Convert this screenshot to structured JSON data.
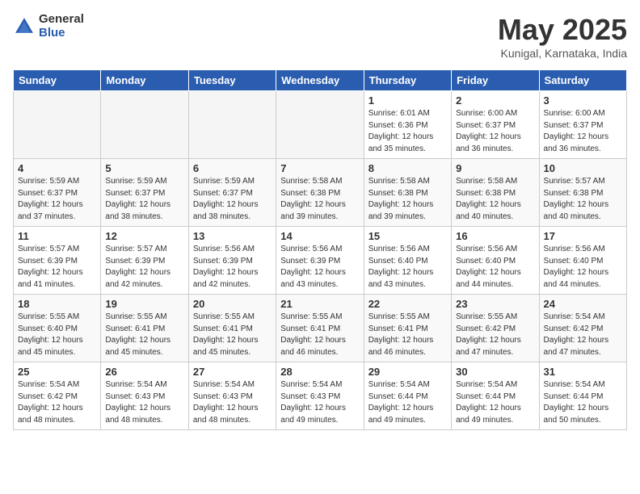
{
  "logo": {
    "general": "General",
    "blue": "Blue"
  },
  "title": "May 2025",
  "location": "Kunigal, Karnataka, India",
  "days_of_week": [
    "Sunday",
    "Monday",
    "Tuesday",
    "Wednesday",
    "Thursday",
    "Friday",
    "Saturday"
  ],
  "weeks": [
    [
      {
        "num": "",
        "empty": true
      },
      {
        "num": "",
        "empty": true
      },
      {
        "num": "",
        "empty": true
      },
      {
        "num": "",
        "empty": true
      },
      {
        "num": "1",
        "sunrise": "6:01 AM",
        "sunset": "6:36 PM",
        "daylight": "12 hours and 35 minutes."
      },
      {
        "num": "2",
        "sunrise": "6:00 AM",
        "sunset": "6:37 PM",
        "daylight": "12 hours and 36 minutes."
      },
      {
        "num": "3",
        "sunrise": "6:00 AM",
        "sunset": "6:37 PM",
        "daylight": "12 hours and 36 minutes."
      }
    ],
    [
      {
        "num": "4",
        "sunrise": "5:59 AM",
        "sunset": "6:37 PM",
        "daylight": "12 hours and 37 minutes."
      },
      {
        "num": "5",
        "sunrise": "5:59 AM",
        "sunset": "6:37 PM",
        "daylight": "12 hours and 38 minutes."
      },
      {
        "num": "6",
        "sunrise": "5:59 AM",
        "sunset": "6:37 PM",
        "daylight": "12 hours and 38 minutes."
      },
      {
        "num": "7",
        "sunrise": "5:58 AM",
        "sunset": "6:38 PM",
        "daylight": "12 hours and 39 minutes."
      },
      {
        "num": "8",
        "sunrise": "5:58 AM",
        "sunset": "6:38 PM",
        "daylight": "12 hours and 39 minutes."
      },
      {
        "num": "9",
        "sunrise": "5:58 AM",
        "sunset": "6:38 PM",
        "daylight": "12 hours and 40 minutes."
      },
      {
        "num": "10",
        "sunrise": "5:57 AM",
        "sunset": "6:38 PM",
        "daylight": "12 hours and 40 minutes."
      }
    ],
    [
      {
        "num": "11",
        "sunrise": "5:57 AM",
        "sunset": "6:39 PM",
        "daylight": "12 hours and 41 minutes."
      },
      {
        "num": "12",
        "sunrise": "5:57 AM",
        "sunset": "6:39 PM",
        "daylight": "12 hours and 42 minutes."
      },
      {
        "num": "13",
        "sunrise": "5:56 AM",
        "sunset": "6:39 PM",
        "daylight": "12 hours and 42 minutes."
      },
      {
        "num": "14",
        "sunrise": "5:56 AM",
        "sunset": "6:39 PM",
        "daylight": "12 hours and 43 minutes."
      },
      {
        "num": "15",
        "sunrise": "5:56 AM",
        "sunset": "6:40 PM",
        "daylight": "12 hours and 43 minutes."
      },
      {
        "num": "16",
        "sunrise": "5:56 AM",
        "sunset": "6:40 PM",
        "daylight": "12 hours and 44 minutes."
      },
      {
        "num": "17",
        "sunrise": "5:56 AM",
        "sunset": "6:40 PM",
        "daylight": "12 hours and 44 minutes."
      }
    ],
    [
      {
        "num": "18",
        "sunrise": "5:55 AM",
        "sunset": "6:40 PM",
        "daylight": "12 hours and 45 minutes."
      },
      {
        "num": "19",
        "sunrise": "5:55 AM",
        "sunset": "6:41 PM",
        "daylight": "12 hours and 45 minutes."
      },
      {
        "num": "20",
        "sunrise": "5:55 AM",
        "sunset": "6:41 PM",
        "daylight": "12 hours and 45 minutes."
      },
      {
        "num": "21",
        "sunrise": "5:55 AM",
        "sunset": "6:41 PM",
        "daylight": "12 hours and 46 minutes."
      },
      {
        "num": "22",
        "sunrise": "5:55 AM",
        "sunset": "6:41 PM",
        "daylight": "12 hours and 46 minutes."
      },
      {
        "num": "23",
        "sunrise": "5:55 AM",
        "sunset": "6:42 PM",
        "daylight": "12 hours and 47 minutes."
      },
      {
        "num": "24",
        "sunrise": "5:54 AM",
        "sunset": "6:42 PM",
        "daylight": "12 hours and 47 minutes."
      }
    ],
    [
      {
        "num": "25",
        "sunrise": "5:54 AM",
        "sunset": "6:42 PM",
        "daylight": "12 hours and 48 minutes."
      },
      {
        "num": "26",
        "sunrise": "5:54 AM",
        "sunset": "6:43 PM",
        "daylight": "12 hours and 48 minutes."
      },
      {
        "num": "27",
        "sunrise": "5:54 AM",
        "sunset": "6:43 PM",
        "daylight": "12 hours and 48 minutes."
      },
      {
        "num": "28",
        "sunrise": "5:54 AM",
        "sunset": "6:43 PM",
        "daylight": "12 hours and 49 minutes."
      },
      {
        "num": "29",
        "sunrise": "5:54 AM",
        "sunset": "6:44 PM",
        "daylight": "12 hours and 49 minutes."
      },
      {
        "num": "30",
        "sunrise": "5:54 AM",
        "sunset": "6:44 PM",
        "daylight": "12 hours and 49 minutes."
      },
      {
        "num": "31",
        "sunrise": "5:54 AM",
        "sunset": "6:44 PM",
        "daylight": "12 hours and 50 minutes."
      }
    ]
  ]
}
